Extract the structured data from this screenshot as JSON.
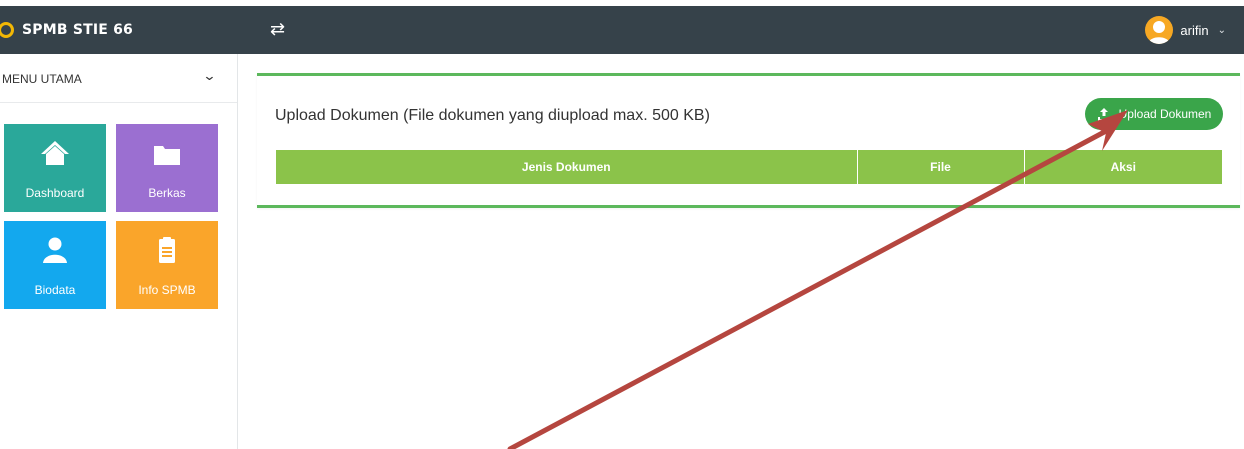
{
  "app": {
    "brand": "SPMB STIE 66",
    "toggle_icon": "⇄",
    "user": {
      "name": "arifin",
      "chevron": "⌄"
    }
  },
  "sidebar": {
    "menu_title": "MENU UTAMA",
    "menu_chevron": "⌄",
    "tiles": [
      {
        "label": "Dashboard",
        "icon": "home-icon",
        "color": "#2aa89a"
      },
      {
        "label": "Berkas",
        "icon": "folder-icon",
        "color": "#9b6fd1"
      },
      {
        "label": "Biodata",
        "icon": "user-icon",
        "color": "#13a8ee"
      },
      {
        "label": "Info SPMB",
        "icon": "clipboard-icon",
        "color": "#faa52a"
      }
    ]
  },
  "main": {
    "title": "Upload Dokumen (File dokumen yang diupload max. 500 KB)",
    "upload_button": "Upload Dokumen",
    "table": {
      "headers": [
        "Jenis Dokumen",
        "File",
        "Aksi"
      ],
      "rows": []
    }
  },
  "colors": {
    "topbar": "#36424a",
    "accent_green": "#5cb85c",
    "table_header": "#8bc34a",
    "button": "#3aa54a",
    "annotation_arrow": "#b5463f"
  }
}
